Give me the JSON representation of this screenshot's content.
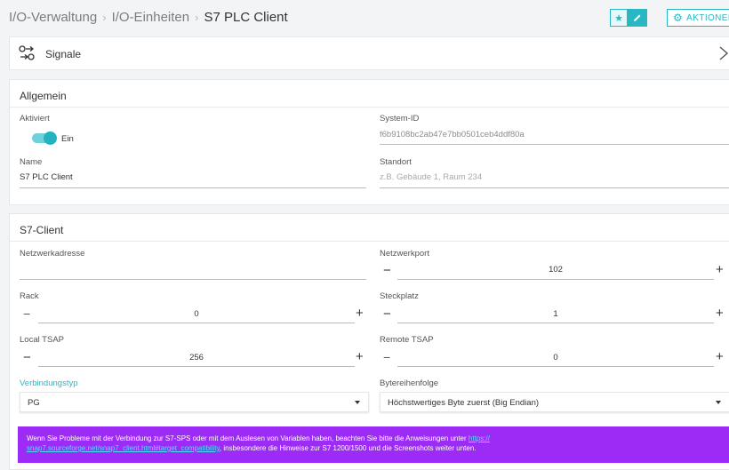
{
  "breadcrumb": {
    "items": [
      "I/O-Verwaltung",
      "I/O-Einheiten"
    ],
    "separator": "›",
    "current": "S7 PLC Client"
  },
  "header": {
    "favorite_icon": "star-icon",
    "edit_icon": "pencil-icon",
    "actions_label": "AKTIONEN"
  },
  "signals": {
    "label": "Signale"
  },
  "general": {
    "title": "Allgemein",
    "active_label": "Aktiviert",
    "active_value": "Ein",
    "system_id_label": "System-ID",
    "system_id_value": "f6b9108bc2ab47e7bb0501ceb4ddf80a",
    "name_label": "Name",
    "name_value": "S7 PLC Client",
    "location_label": "Standort",
    "location_placeholder": "z.B. Gebäude 1, Raum 234"
  },
  "s7": {
    "title": "S7-Client",
    "network_address_label": "Netzwerkadresse",
    "network_address_value": "",
    "network_port_label": "Netzwerkport",
    "network_port_value": "102",
    "rack_label": "Rack",
    "rack_value": "0",
    "slot_label": "Steckplatz",
    "slot_value": "1",
    "local_tsap_label": "Local TSAP",
    "local_tsap_value": "256",
    "remote_tsap_label": "Remote TSAP",
    "remote_tsap_value": "0",
    "connection_type_label": "Verbindungstyp",
    "connection_type_value": "PG",
    "byte_order_label": "Bytereihenfolge",
    "byte_order_value": "Höchstwertiges Byte zuerst (Big Endian)",
    "minus": "−",
    "plus": "+"
  },
  "notice": {
    "text_before": "Wenn Sie Probleme mit der Verbindung zur S7-SPS oder mit dem Auslesen von Variablen haben, beachten Sie bitte die Anweisungen unter ",
    "link_line1": "https://",
    "link_line2": "snap7.sourceforge.net/snap7_client.html#target_compatibility",
    "text_after": ", insbesondere die Hinweise zur S7 1200/1500 und die Screenshots weiter unten."
  },
  "colors": {
    "accent": "#29b7c3",
    "notice_bg": "#9b2bf5",
    "notice_link": "#4fe1ff"
  }
}
